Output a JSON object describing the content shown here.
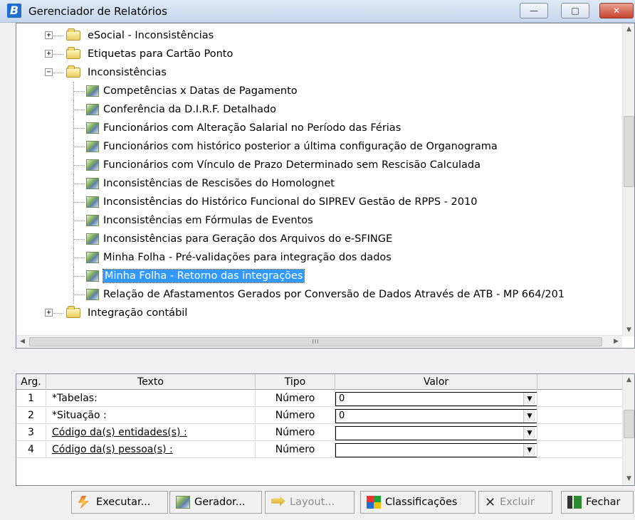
{
  "window": {
    "title": "Gerenciador de Relatórios",
    "app_icon_letter": "B",
    "controls": [
      "minimize",
      "maximize",
      "close"
    ]
  },
  "tree": {
    "nodes": [
      {
        "label": "eSocial - Inconsistências",
        "type": "folder",
        "expander": "+",
        "level": 0
      },
      {
        "label": "Etiquetas para Cartão Ponto",
        "type": "folder",
        "expander": "+",
        "level": 0
      },
      {
        "label": "Inconsistências",
        "type": "folder-open",
        "expander": "-",
        "level": 0
      },
      {
        "label": "Competências x Datas de Pagamento",
        "type": "report",
        "level": 1
      },
      {
        "label": "Conferência da D.I.R.F. Detalhado",
        "type": "report",
        "level": 1
      },
      {
        "label": "Funcionários com Alteração Salarial no Período das Férias",
        "type": "report",
        "level": 1
      },
      {
        "label": "Funcionários com histórico posterior a última configuração de Organograma",
        "type": "report",
        "level": 1
      },
      {
        "label": "Funcionários com Vínculo de Prazo Determinado sem Rescisão Calculada",
        "type": "report",
        "level": 1
      },
      {
        "label": "Inconsistências de Rescisões do Homolognet",
        "type": "report",
        "level": 1
      },
      {
        "label": "Inconsistências do Histórico Funcional do SIPREV Gestão de RPPS - 2010",
        "type": "report",
        "level": 1
      },
      {
        "label": "Inconsistências em Fórmulas de Eventos",
        "type": "report",
        "level": 1
      },
      {
        "label": "Inconsistências para Geração dos Arquivos do e-SFINGE",
        "type": "report",
        "level": 1
      },
      {
        "label": "Minha Folha - Pré-validações para integração dos dados",
        "type": "report",
        "level": 1
      },
      {
        "label": "Minha Folha - Retorno das integrações",
        "type": "report",
        "level": 1,
        "selected": true
      },
      {
        "label": "Relação de Afastamentos Gerados por Conversão de Dados Através de ATB - MP 664/201",
        "type": "report",
        "level": 1
      },
      {
        "label": "Integração contábil",
        "type": "folder",
        "expander": "+",
        "level": 0
      }
    ],
    "hscroll_grip": "III"
  },
  "params": {
    "headers": {
      "arg": "Arg.",
      "texto": "Texto",
      "tipo": "Tipo",
      "valor": "Valor"
    },
    "rows": [
      {
        "arg": "1",
        "texto": "*Tabelas:",
        "tipo": "Número",
        "valor": "0",
        "underline": false
      },
      {
        "arg": "2",
        "texto": "*Situação :",
        "tipo": "Número",
        "valor": "0",
        "underline": false
      },
      {
        "arg": "3",
        "texto": "Código da(s) entidades(s) :",
        "tipo": "Número",
        "valor": "",
        "underline": true
      },
      {
        "arg": "4",
        "texto": "Código da(s) pessoa(s) :",
        "tipo": "Número",
        "valor": "",
        "underline": true
      }
    ]
  },
  "toolbar": {
    "executar": "Executar...",
    "gerador": "Gerador...",
    "layout": "Layout...",
    "classificacoes": "Classificações",
    "excluir": "Excluir",
    "fechar": "Fechar"
  },
  "icons": {
    "executar": "lightning-icon",
    "gerador": "report-generator-icon",
    "layout": "layout-icon",
    "classificacoes": "classification-icon",
    "excluir": "x-icon",
    "fechar": "exit-door-icon"
  }
}
